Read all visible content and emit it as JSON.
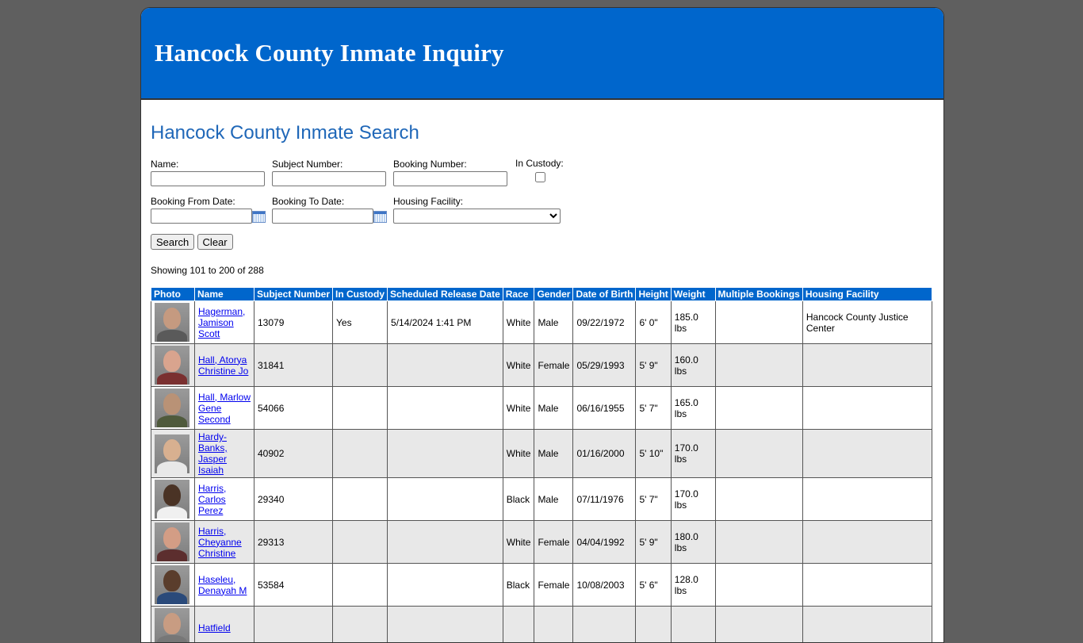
{
  "header": {
    "title": "Hancock County Inmate Inquiry"
  },
  "page": {
    "heading": "Hancock County Inmate Search"
  },
  "search": {
    "name_label": "Name:",
    "subject_label": "Subject Number:",
    "booking_label": "Booking Number:",
    "custody_label": "In Custody:",
    "from_label": "Booking From Date:",
    "to_label": "Booking To Date:",
    "facility_label": "Housing Facility:",
    "search_button": "Search",
    "clear_button": "Clear"
  },
  "results": {
    "showing": "Showing 101 to 200 of 288",
    "columns": [
      "Photo",
      "Name",
      "Subject Number",
      "In Custody",
      "Scheduled Release Date",
      "Race",
      "Gender",
      "Date of Birth",
      "Height",
      "Weight",
      "Multiple Bookings",
      "Housing Facility"
    ],
    "rows": [
      {
        "name": "Hagerman, Jamison Scott",
        "subject": "13079",
        "custody": "Yes",
        "release": "5/14/2024 1:41 PM",
        "race": "White",
        "gender": "Male",
        "dob": "09/22/1972",
        "height": "6' 0\"",
        "weight": "185.0 lbs",
        "multiple": "",
        "facility": "Hancock County Justice Center",
        "skin": "#c59a80",
        "shirt": "#5a5a5a"
      },
      {
        "name": "Hall, Atorya Christine Jo",
        "subject": "31841",
        "custody": "",
        "release": "",
        "race": "White",
        "gender": "Female",
        "dob": "05/29/1993",
        "height": "5' 9\"",
        "weight": "160.0 lbs",
        "multiple": "",
        "facility": "",
        "skin": "#d9a48e",
        "shirt": "#7a3030"
      },
      {
        "name": "Hall, Marlow Gene Second",
        "subject": "54066",
        "custody": "",
        "release": "",
        "race": "White",
        "gender": "Male",
        "dob": "06/16/1955",
        "height": "5' 7\"",
        "weight": "165.0 lbs",
        "multiple": "",
        "facility": "",
        "skin": "#b99276",
        "shirt": "#4f5a3c"
      },
      {
        "name": "Hardy-Banks, Jasper Isaiah",
        "subject": "40902",
        "custody": "",
        "release": "",
        "race": "White",
        "gender": "Male",
        "dob": "01/16/2000",
        "height": "5' 10\"",
        "weight": "170.0 lbs",
        "multiple": "",
        "facility": "",
        "skin": "#d8b090",
        "shirt": "#e8e8e8"
      },
      {
        "name": "Harris, Carlos Perez",
        "subject": "29340",
        "custody": "",
        "release": "",
        "race": "Black",
        "gender": "Male",
        "dob": "07/11/1976",
        "height": "5' 7\"",
        "weight": "170.0 lbs",
        "multiple": "",
        "facility": "",
        "skin": "#4a3325",
        "shirt": "#f0f0f0"
      },
      {
        "name": "Harris, Cheyanne Christine",
        "subject": "29313",
        "custody": "",
        "release": "",
        "race": "White",
        "gender": "Female",
        "dob": "04/04/1992",
        "height": "5' 9\"",
        "weight": "180.0 lbs",
        "multiple": "",
        "facility": "",
        "skin": "#d39d85",
        "shirt": "#5c2e2e"
      },
      {
        "name": "Haseleu, Denayah M",
        "subject": "53584",
        "custody": "",
        "release": "",
        "race": "Black",
        "gender": "Female",
        "dob": "10/08/2003",
        "height": "5' 6\"",
        "weight": "128.0 lbs",
        "multiple": "",
        "facility": "",
        "skin": "#5a3d2c",
        "shirt": "#2a4a7a"
      },
      {
        "name": "Hatfield",
        "subject": "",
        "custody": "",
        "release": "",
        "race": "",
        "gender": "",
        "dob": "",
        "height": "",
        "weight": "",
        "multiple": "",
        "facility": "",
        "skin": "#c89c82",
        "shirt": "#777777"
      }
    ]
  }
}
